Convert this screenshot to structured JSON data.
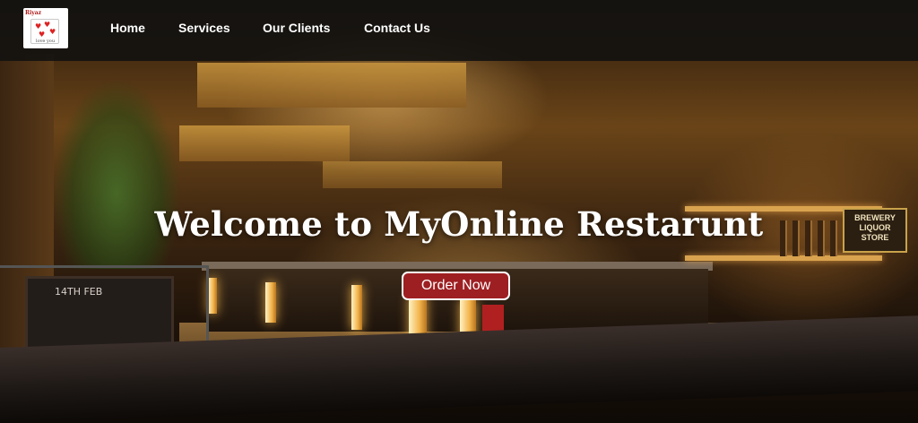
{
  "nav": {
    "logo": {
      "brand_text": "Riyaz",
      "sub_text": "love you",
      "icon": "mug-logo-icon"
    },
    "links": [
      {
        "label": "Home"
      },
      {
        "label": "Services"
      },
      {
        "label": "Our Clients"
      },
      {
        "label": "Contact Us"
      }
    ]
  },
  "hero": {
    "title": "Welcome to MyOnline Restarunt",
    "cta_label": "Order Now",
    "background_sign": "BREWERY LIQUOR STORE",
    "chalkboard_text": "14TH FEB"
  },
  "colors": {
    "navbar_bg": "#141210",
    "cta_bg": "#9e1f22",
    "text": "#ffffff"
  }
}
